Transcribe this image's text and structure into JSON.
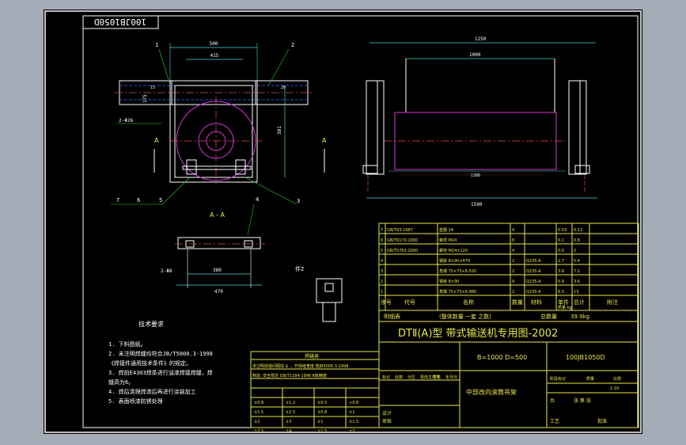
{
  "drawing": {
    "drawing_number_rotated": "100JB1050D",
    "section_label": "A - A",
    "view_marker": "A",
    "note_mark": "件2",
    "tech_req_title": "技术要求"
  },
  "balloons": [
    "1",
    "2",
    "7",
    "6",
    "5",
    "3",
    "4"
  ],
  "dimensions": {
    "front": [
      "500",
      "415",
      "175",
      "15",
      "381",
      "20",
      "2-Φ26"
    ],
    "side": [
      "1250",
      "1000",
      "1590",
      "1380"
    ],
    "section": [
      "380",
      "470",
      "2-Φ8"
    ]
  },
  "tech_notes": [
    "1. 下料图纸。",
    "2. 未注明焊缝均符合JB/T5000.3-1998",
    "   《焊接件通用技术条件》的规定。",
    "3. 焊前E4303焊条进行油漆焊接焊缝，焊",
    "   缝高为6。",
    "4. 焊后清理焊渣后再进行涂装加工",
    "5. 表面喷漆防锈处理"
  ],
  "weld_table": {
    "title": "焊缝表",
    "row1": "未注明焊缝间隔焊 Δ ... 开焊缝宽度 按JB5000.3-1998",
    "row2": "制造. 安全规定 GB/T1184-1996 K级精度",
    "rows": [
      [
        "±0.8",
        "±1.2",
        "±0.5",
        "+0.8"
      ],
      [
        "±1.5",
        "±2.5",
        "±0.8",
        "±1"
      ],
      [
        "±2",
        "±3",
        "±1",
        "±1.5"
      ],
      [
        "±2.5",
        "±4",
        "±1.5",
        "±2"
      ]
    ]
  },
  "bom": {
    "rows": [
      [
        "7",
        "GB/T93-1987",
        "垫圈 24",
        "4",
        "",
        "0.03",
        "0.12"
      ],
      [
        "6",
        "GB/T6170-2000",
        "螺母 M24",
        "8",
        "",
        "0.1",
        "0.8"
      ],
      [
        "5",
        "GB/T5782-2000",
        "螺栓 M24×120",
        "4",
        "",
        "0.5",
        "2"
      ],
      [
        "4",
        "",
        "钢板 8×90×470",
        "2",
        "Q235-A",
        "2.7",
        "5.4"
      ],
      [
        "3",
        "",
        "角钢 75×75×6-520",
        "2",
        "Q235-A",
        "3.6",
        "7.2"
      ],
      [
        "2",
        "",
        "钢板 8×90",
        "4",
        "Q235-A",
        "0.9",
        "3.6"
      ],
      [
        "1",
        "",
        "角钢 75×75×6-980",
        "2",
        "Q235-A",
        "6.5",
        "13"
      ]
    ],
    "header": [
      "序号",
      "代号",
      "名称",
      "数量",
      "材料",
      "单件",
      "总计",
      "附注"
    ],
    "weight_unit": "质量 kg",
    "detail_label": "明细表",
    "detail_note": "(整体数量 一套 之数)",
    "total_mass_label": "总数量",
    "total_mass": "39.9kg"
  },
  "title_block": {
    "model_title": "DTⅡ(A)型  带式输送机专用图-2002",
    "spec": "B=1000  D=500",
    "drawing_no": "100JB1050D",
    "part_name": "中部改向滚筒吊架",
    "scale": "1:10",
    "stage_label": "阶段标记",
    "weight_label": "质量",
    "scale_label": "比例",
    "sheet_label": "共",
    "sheet_of": "张  第  张",
    "rev_header": [
      "标记",
      "处数",
      "分区",
      "更改文件号",
      "签名",
      "年月日"
    ],
    "signers": [
      "设计",
      "审核",
      "工艺",
      "批准"
    ]
  },
  "colors": {
    "frame": "#ffffff",
    "outline": "#ffffff",
    "centerline": "#e05050",
    "dimension": "#3fd9d0",
    "hidden": "#3a6cff",
    "roller": "#d436d4",
    "table": "#e8e84a",
    "leader": "#2ad02a"
  }
}
